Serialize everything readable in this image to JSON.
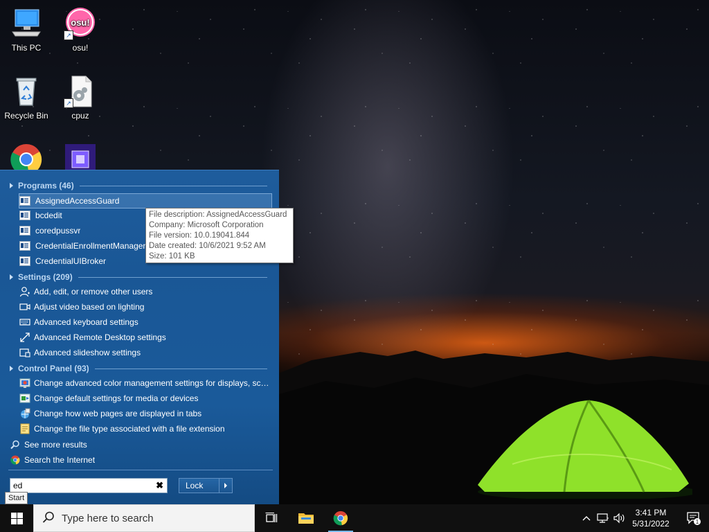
{
  "desktop": {
    "icons": [
      {
        "label": "This PC"
      },
      {
        "label": "osu!"
      },
      {
        "label": "Recycle Bin"
      },
      {
        "label": "cpuz"
      },
      {
        "label": ""
      },
      {
        "label": ""
      }
    ]
  },
  "start_menu": {
    "groups": {
      "programs": {
        "title": "Programs (46)"
      },
      "settings": {
        "title": "Settings (209)"
      },
      "control_panel": {
        "title": "Control Panel (93)"
      }
    },
    "programs": [
      {
        "label": "AssignedAccessGuard",
        "icon": "exe-icon",
        "selected": true
      },
      {
        "label": "bcdedit",
        "icon": "exe-icon"
      },
      {
        "label": "coredpussvr",
        "icon": "exe-icon"
      },
      {
        "label": "CredentialEnrollmentManager",
        "icon": "exe-icon"
      },
      {
        "label": "CredentialUIBroker",
        "icon": "exe-icon"
      }
    ],
    "settings": [
      {
        "label": "Add, edit, or remove other users",
        "icon": "person-icon"
      },
      {
        "label": "Adjust video based on lighting",
        "icon": "video-icon"
      },
      {
        "label": "Advanced keyboard settings",
        "icon": "keyboard-icon"
      },
      {
        "label": "Advanced Remote Desktop settings",
        "icon": "remote-desktop-icon"
      },
      {
        "label": "Advanced slideshow settings",
        "icon": "slideshow-icon"
      }
    ],
    "control_panel": [
      {
        "label": "Change advanced color management settings for displays, sca...",
        "icon": "color-management-icon"
      },
      {
        "label": "Change default settings for media or devices",
        "icon": "autoplay-icon"
      },
      {
        "label": "Change how web pages are displayed in tabs",
        "icon": "internet-options-icon"
      },
      {
        "label": "Change the file type associated with a file extension",
        "icon": "default-programs-icon"
      }
    ],
    "see_more": "See more results",
    "search_internet": "Search the Internet",
    "search_value": "ed",
    "clear_glyph": "✖",
    "lock_label": "Lock",
    "start_tooltip": "Start"
  },
  "tooltip": {
    "lines": [
      "File description: AssignedAccessGuard",
      "Company: Microsoft Corporation",
      "File version: 10.0.19041.844",
      "Date created: 10/6/2021 9:52 AM",
      "Size: 101 KB"
    ]
  },
  "taskbar": {
    "search_placeholder": "Type here to search",
    "time": "3:41 PM",
    "date": "5/31/2022",
    "notification_count": "1"
  },
  "colors": {
    "start_menu_bg": "#1a5796",
    "group_title": "#bcd7f2",
    "taskbar_bg": "#101010",
    "accent": "#76b9ed"
  }
}
